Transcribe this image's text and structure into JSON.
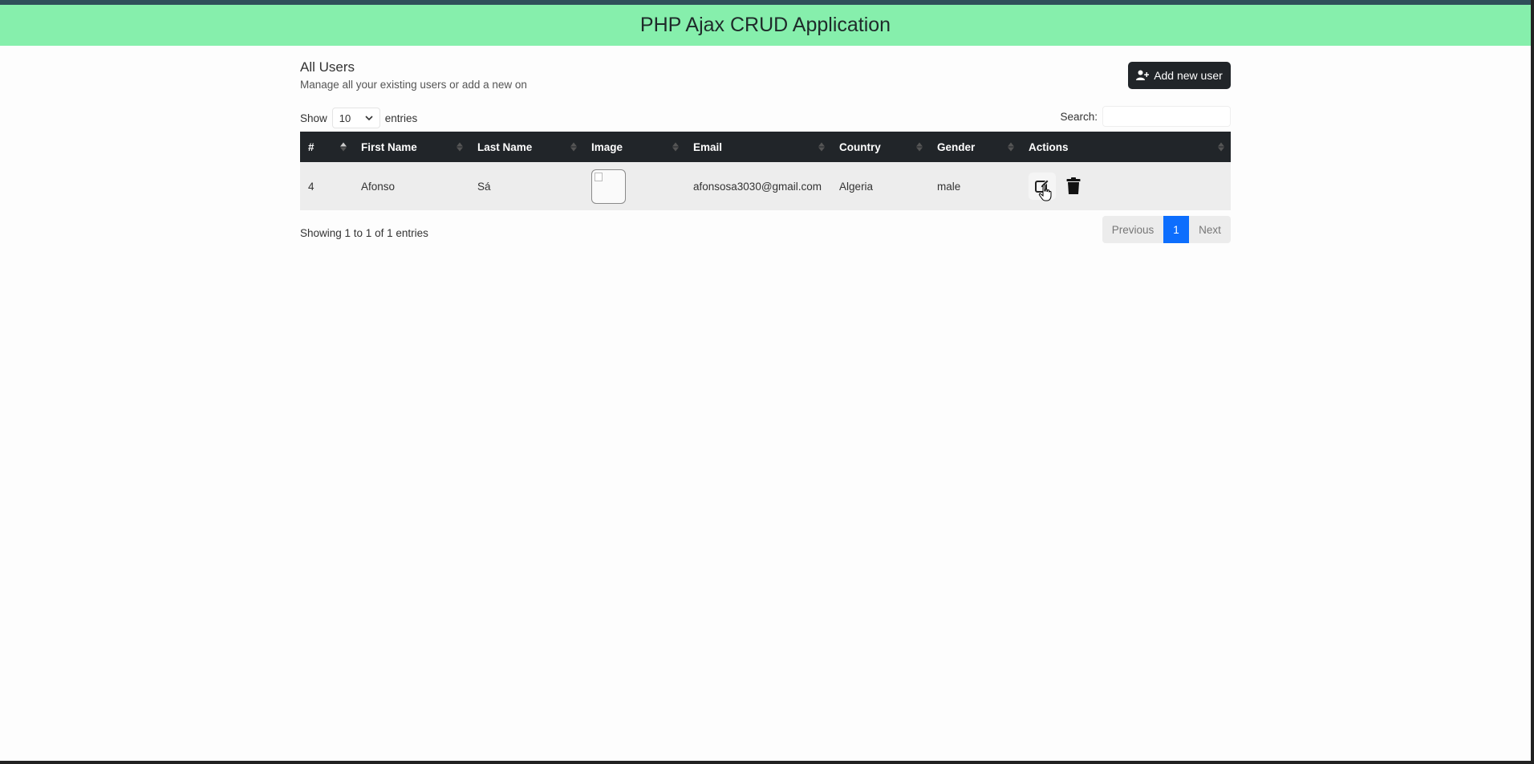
{
  "app": {
    "title": "PHP Ajax CRUD Application"
  },
  "page": {
    "title": "All Users",
    "subtitle": "Manage all your existing users or add a new on",
    "add_button_label": "Add new user"
  },
  "controls": {
    "show_label": "Show",
    "entries_value": "10",
    "entries_label": "entries",
    "search_label": "Search:",
    "search_value": ""
  },
  "table": {
    "columns": [
      "#",
      "First Name",
      "Last Name",
      "Image",
      "Email",
      "Country",
      "Gender",
      "Actions"
    ],
    "rows": [
      {
        "id": "4",
        "first_name": "Afonso",
        "last_name": "Sá",
        "email": "afonsosa3030@gmail.com",
        "country": "Algeria",
        "gender": "male"
      }
    ]
  },
  "footer": {
    "info": "Showing 1 to 1 of 1 entries",
    "prev_label": "Previous",
    "page": "1",
    "next_label": "Next"
  },
  "icons": {
    "add_user": "user-plus-icon",
    "edit": "edit-icon",
    "delete": "trash-icon",
    "sort": "sort-icon",
    "dropdown": "chevron-down-icon",
    "cursor": "hand-cursor-icon"
  },
  "colors": {
    "header_bg": "#86efac",
    "dark": "#212529",
    "primary": "#0d6efd"
  }
}
